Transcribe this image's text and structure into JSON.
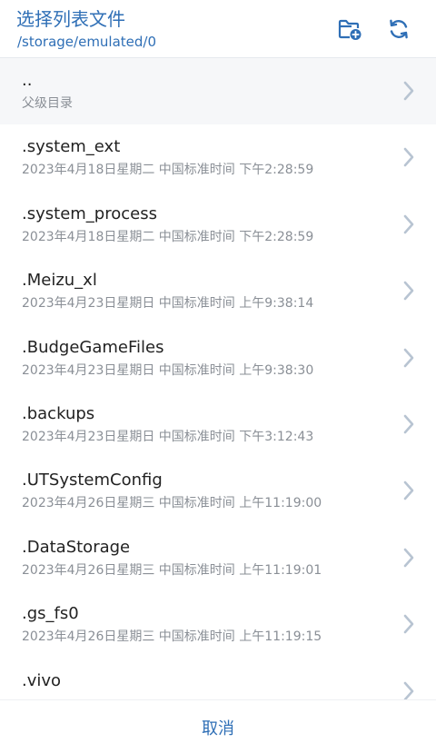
{
  "header": {
    "title": "选择列表文件",
    "path": "/storage/emulated/0",
    "icons": {
      "new_folder": "new-folder-icon",
      "refresh": "refresh-icon"
    }
  },
  "list": {
    "parent": {
      "name": "..",
      "subtitle": "父级目录"
    },
    "items": [
      {
        "name": ".system_ext",
        "date": "2023年4月18日星期二 中国标准时间 下午2:28:59"
      },
      {
        "name": ".system_process",
        "date": "2023年4月18日星期二 中国标准时间 下午2:28:59"
      },
      {
        "name": ".Meizu_xl",
        "date": "2023年4月23日星期日 中国标准时间 上午9:38:14"
      },
      {
        "name": ".BudgeGameFiles",
        "date": "2023年4月23日星期日 中国标准时间 上午9:38:30"
      },
      {
        "name": ".backups",
        "date": "2023年4月23日星期日 中国标准时间 下午3:12:43"
      },
      {
        "name": ".UTSystemConfig",
        "date": "2023年4月26日星期三 中国标准时间 上午11:19:00"
      },
      {
        "name": ".DataStorage",
        "date": "2023年4月26日星期三 中国标准时间 上午11:19:01"
      },
      {
        "name": ".gs_fs0",
        "date": "2023年4月26日星期三 中国标准时间 上午11:19:15"
      },
      {
        "name": ".vivo",
        "date": ""
      }
    ]
  },
  "footer": {
    "cancel_label": "取消"
  },
  "colors": {
    "accent": "#2f6fb6",
    "chevron": "#b8c4d2",
    "parent_bg": "#f6f7f9"
  }
}
